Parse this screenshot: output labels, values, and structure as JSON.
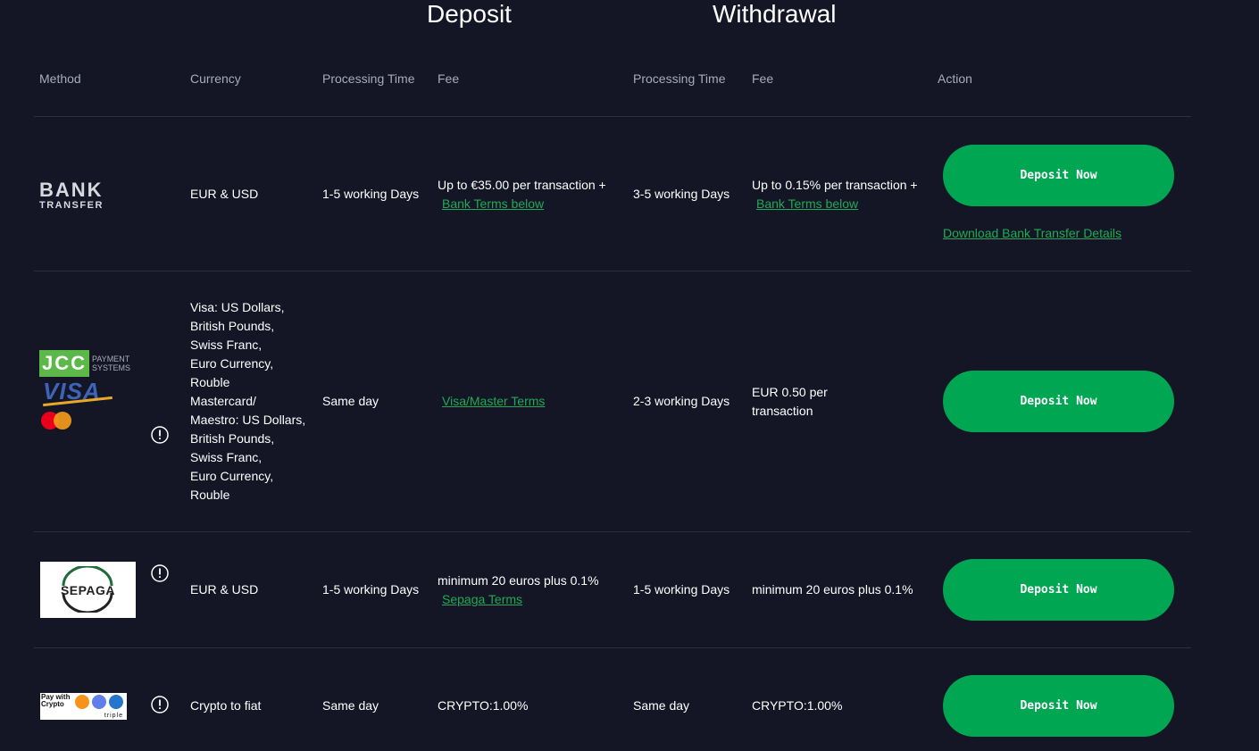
{
  "headers": {
    "deposit_group": "Deposit",
    "withdrawal_group": "Withdrawal",
    "columns": {
      "method": "Method",
      "currency": "Currency",
      "deposit_processing_time": "Processing Time",
      "deposit_fee": "Fee",
      "withdrawal_processing_time": "Processing Time",
      "withdrawal_fee": "Fee",
      "action": "Action"
    }
  },
  "rows": [
    {
      "method": "Bank Transfer",
      "logo": {
        "line1": "BANK",
        "line2": "TRANSFER"
      },
      "currency": "EUR & USD",
      "deposit_processing_time": "1-5 working Days",
      "deposit_fee": "Up to €35.00 per transaction +",
      "deposit_fee_link": "Bank Terms below",
      "withdrawal_processing_time": "3-5 working Days",
      "withdrawal_fee": "Up to 0.15% per transaction +",
      "withdrawal_fee_link": "Bank Terms below",
      "action_label": "Deposit Now",
      "extra_link": "Download Bank Transfer Details"
    },
    {
      "method": "JCC Payment Systems",
      "logo": {
        "brand": "JCC",
        "subtitle_line1": "PAYMENT",
        "subtitle_line2": "SYSTEMS",
        "card": "VISA"
      },
      "currency_lines": [
        "Visa: US Dollars,",
        "British Pounds,",
        "Swiss Franc,",
        "Euro Currency,",
        "Rouble",
        "Mastercard/",
        "Maestro: US Dollars,",
        "British Pounds,",
        "Swiss Franc,",
        "Euro Currency,",
        "Rouble"
      ],
      "deposit_processing_time": "Same day",
      "deposit_fee_link": "Visa/Master Terms",
      "withdrawal_processing_time": "2-3 working Days",
      "withdrawal_fee_lines": [
        "EUR 0.50 per",
        "transaction"
      ],
      "action_label": "Deposit Now"
    },
    {
      "method": "Sepaga",
      "logo": {
        "brand": "SEPAGA"
      },
      "currency": "EUR & USD",
      "deposit_processing_time": "1-5 working Days",
      "deposit_fee": "minimum 20 euros plus 0.1%",
      "deposit_fee_link": "Sepaga Terms",
      "withdrawal_processing_time": "1-5 working Days",
      "withdrawal_fee": "minimum 20 euros plus 0.1%",
      "action_label": "Deposit Now"
    },
    {
      "method": "Pay with Crypto",
      "logo": {
        "line1": "Pay with",
        "line2": "Crypto",
        "brand": "triple"
      },
      "currency": "Crypto to fiat",
      "deposit_processing_time": "Same day",
      "deposit_fee": "CRYPTO:1.00%",
      "withdrawal_processing_time": "Same day",
      "withdrawal_fee": "CRYPTO:1.00%",
      "action_label": "Deposit Now"
    }
  ],
  "colors": {
    "background": "#141626",
    "accent_green": "#00a651",
    "link_green": "#1faa55",
    "header_gray": "#a8abb8",
    "divider": "#2c2f42"
  }
}
